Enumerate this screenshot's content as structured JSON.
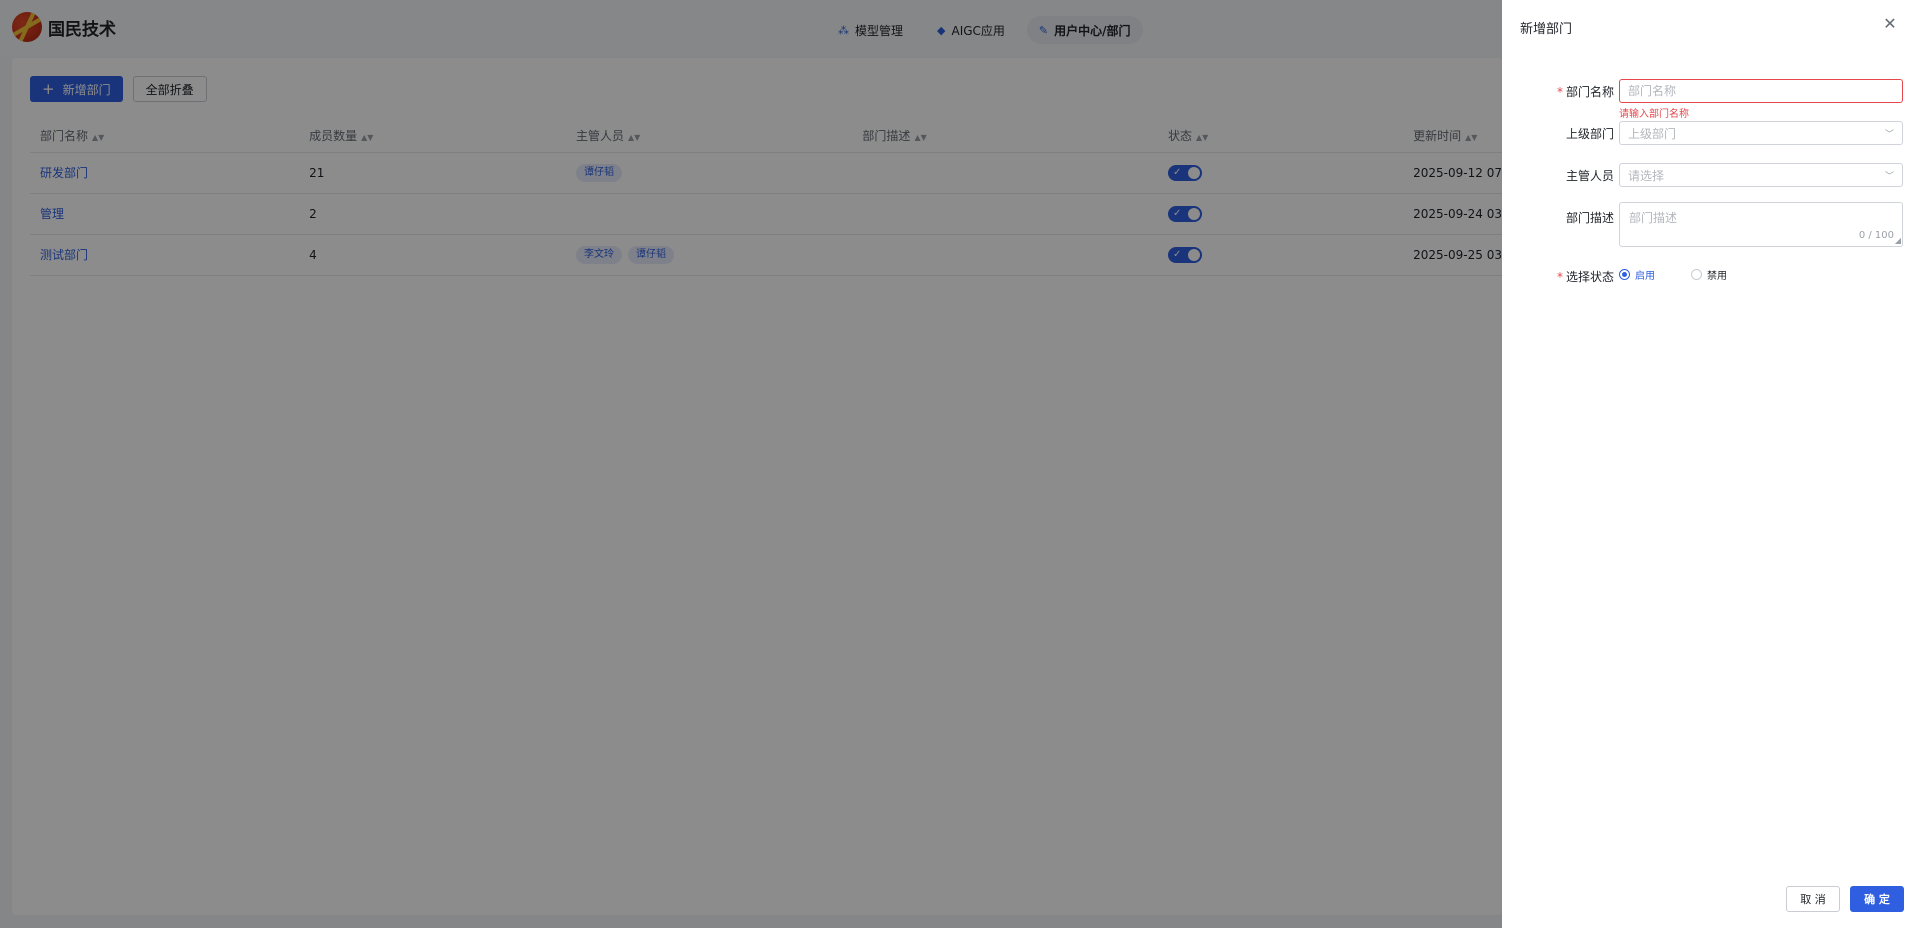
{
  "brand": {
    "name": "国民技术"
  },
  "nav": {
    "tabs": [
      {
        "label": "模型管理",
        "icon": "model-icon",
        "active": false
      },
      {
        "label": "AIGC应用",
        "icon": "aigc-icon",
        "active": false
      },
      {
        "label": "用户中心/部门",
        "icon": "user-center-icon",
        "active": true
      }
    ]
  },
  "toolbar": {
    "add_label": "新增部门",
    "collapse_label": "全部折叠"
  },
  "table": {
    "columns": [
      "部门名称",
      "成员数量",
      "主管人员",
      "部门描述",
      "状态",
      "更新时间"
    ],
    "rows": [
      {
        "name": "研发部门",
        "members": "21",
        "managers": [
          "谭仔韬"
        ],
        "description": "",
        "enabled": true,
        "updated": "2025-09-12 07"
      },
      {
        "name": "管理",
        "members": "2",
        "managers": [],
        "description": "",
        "enabled": true,
        "updated": "2025-09-24 03"
      },
      {
        "name": "测试部门",
        "members": "4",
        "managers": [
          "李文玲",
          "谭仔韬"
        ],
        "description": "",
        "enabled": true,
        "updated": "2025-09-25 03"
      }
    ]
  },
  "drawer": {
    "title": "新增部门",
    "fields": {
      "name": {
        "label": "部门名称",
        "required": true,
        "placeholder": "部门名称",
        "value": "",
        "error": "请输入部门名称"
      },
      "parent": {
        "label": "上级部门",
        "placeholder": "上级部门"
      },
      "manager": {
        "label": "主管人员",
        "placeholder": "请选择"
      },
      "description": {
        "label": "部门描述",
        "placeholder": "部门描述",
        "counter": "0 / 100"
      },
      "status": {
        "label": "选择状态",
        "required": true,
        "options": [
          "启用",
          "禁用"
        ],
        "selected": "启用"
      }
    },
    "cancel_label": "取 消",
    "ok_label": "确 定"
  },
  "colors": {
    "primary": "#2f5fe0",
    "error": "#e5484d",
    "overlay": "rgba(0,0,0,0.45)"
  }
}
